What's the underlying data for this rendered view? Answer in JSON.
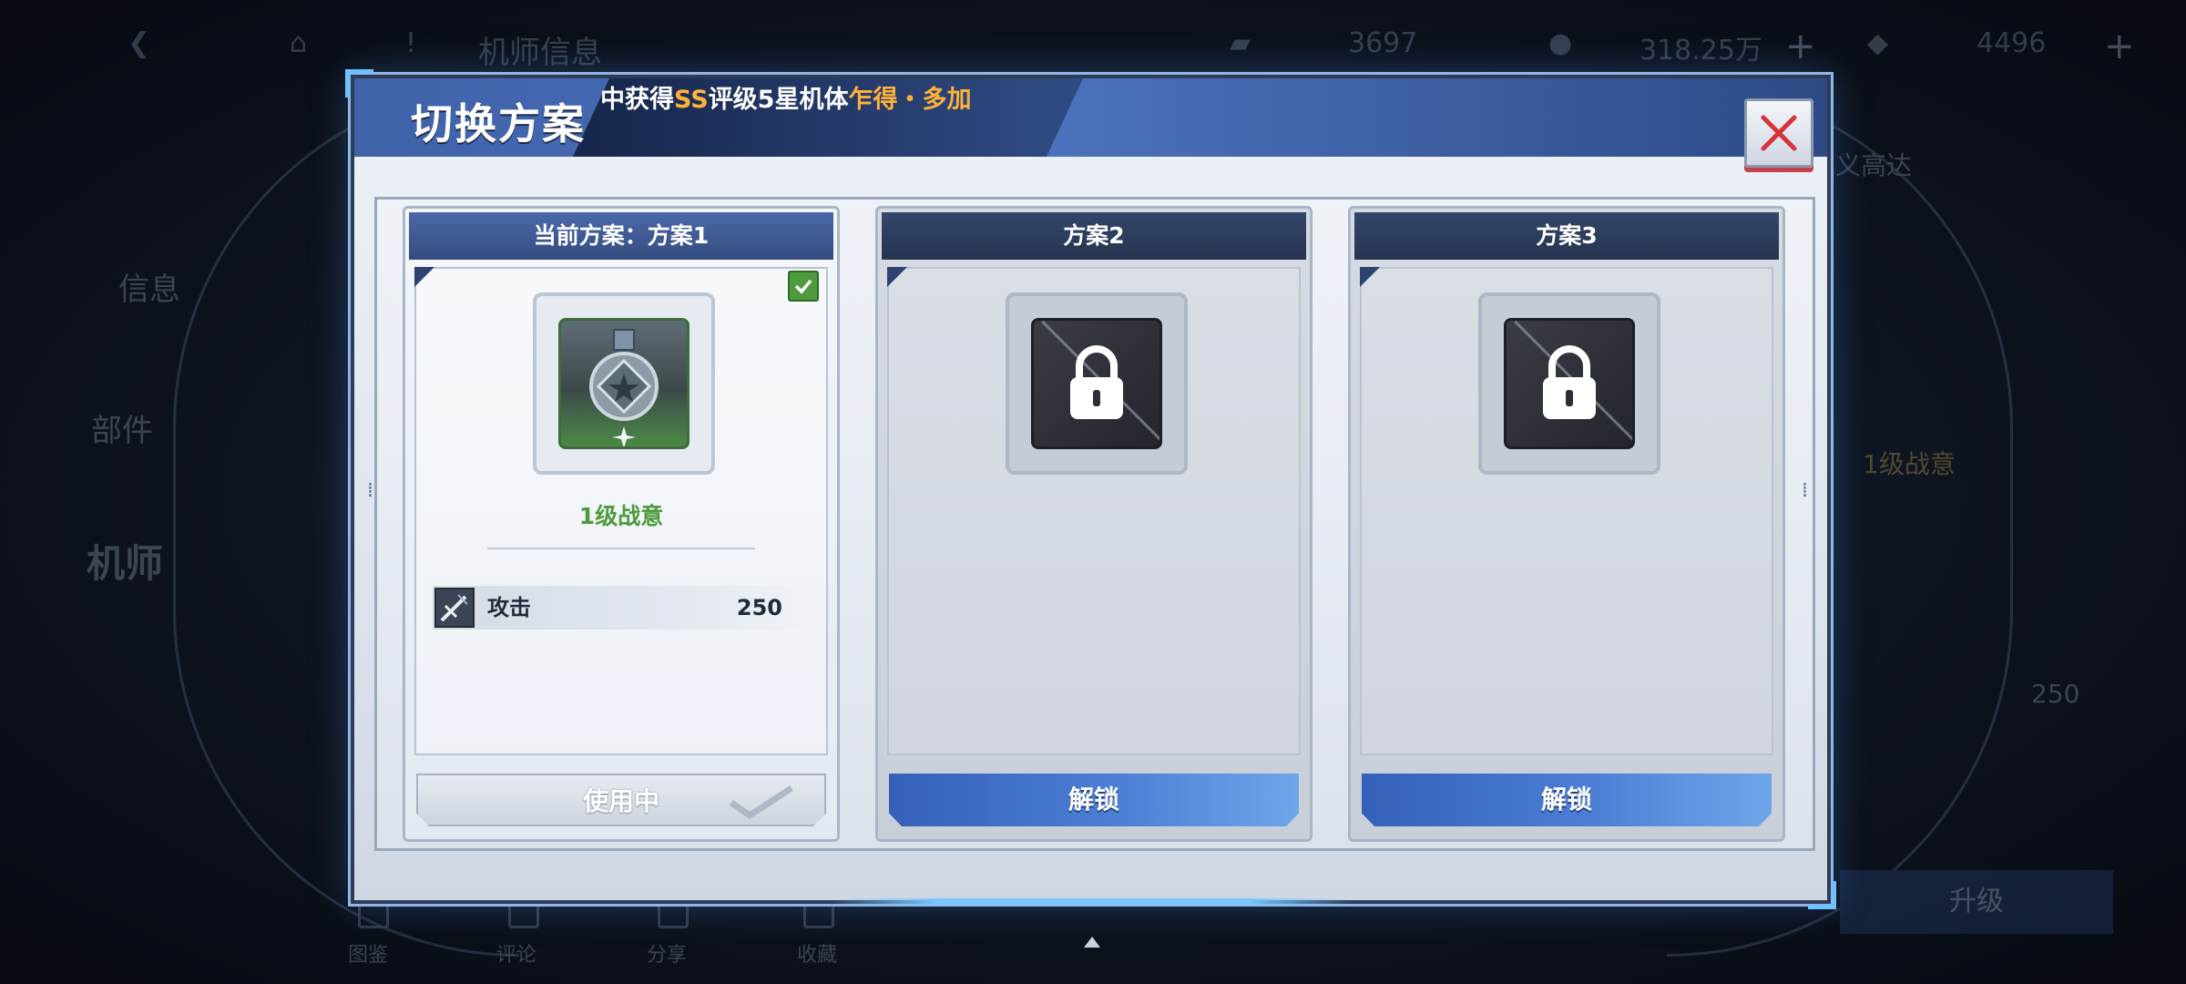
{
  "background": {
    "topbar": {
      "title": "机师信息",
      "currency1": "3697",
      "currency2": "318.25万",
      "currency3": "4496"
    },
    "side_tabs": [
      "信息",
      "部件",
      "机师"
    ],
    "right_texts": {
      "unit_name": "义高达",
      "level": "1级战意",
      "value": "250"
    },
    "upgrade_label": "升级",
    "bottom_tabs": [
      "图鉴",
      "评论",
      "分享",
      "收藏"
    ]
  },
  "dialog": {
    "title": "切换方案",
    "marquee": {
      "part1": "中获得",
      "part2": "SS",
      "part3": "评级5星机体",
      "part4": "乍得・多加"
    }
  },
  "cards": [
    {
      "header": "当前方案：方案1",
      "state": "active",
      "level": "1级战意",
      "stat_label": "攻击",
      "stat_value": "250",
      "button": "使用中"
    },
    {
      "header": "方案2",
      "state": "locked",
      "button": "解锁"
    },
    {
      "header": "方案3",
      "state": "locked",
      "button": "解锁"
    }
  ],
  "colors": {
    "accent_blue": "#4b7ed4",
    "success_green": "#4e9a3c",
    "highlight_orange": "#ffb23a",
    "close_red": "#d8323c"
  },
  "icons": {
    "close": "close-icon",
    "lock": "lock-icon",
    "medal": "medal-icon",
    "check": "check-icon",
    "attack": "attack-icon"
  }
}
